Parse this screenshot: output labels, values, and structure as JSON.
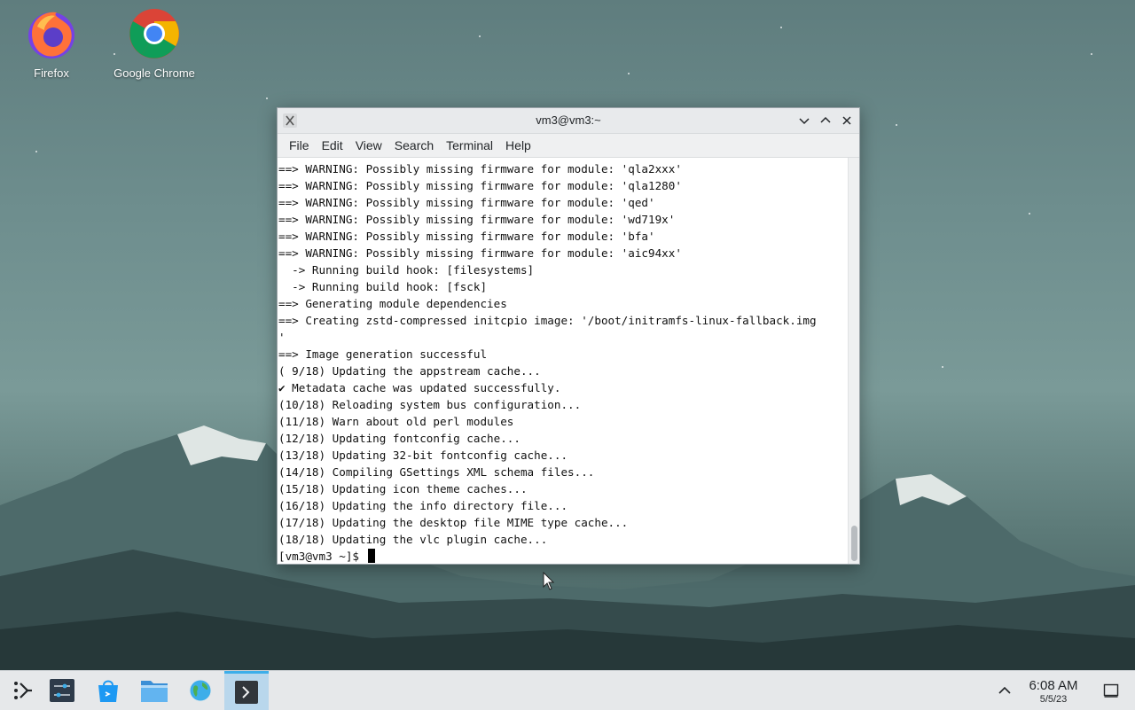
{
  "desktop": {
    "icons": [
      {
        "label": "Firefox"
      },
      {
        "label": "Google Chrome"
      }
    ]
  },
  "window": {
    "title": "vm3@vm3:~",
    "menu": [
      "File",
      "Edit",
      "View",
      "Search",
      "Terminal",
      "Help"
    ]
  },
  "terminal": {
    "lines": [
      "==> WARNING: Possibly missing firmware for module: 'qla2xxx'",
      "==> WARNING: Possibly missing firmware for module: 'qla1280'",
      "==> WARNING: Possibly missing firmware for module: 'qed'",
      "==> WARNING: Possibly missing firmware for module: 'wd719x'",
      "==> WARNING: Possibly missing firmware for module: 'bfa'",
      "==> WARNING: Possibly missing firmware for module: 'aic94xx'",
      "  -> Running build hook: [filesystems]",
      "  -> Running build hook: [fsck]",
      "==> Generating module dependencies",
      "==> Creating zstd-compressed initcpio image: '/boot/initramfs-linux-fallback.img",
      "'",
      "==> Image generation successful",
      "( 9/18) Updating the appstream cache...",
      "✔ Metadata cache was updated successfully.",
      "(10/18) Reloading system bus configuration...",
      "(11/18) Warn about old perl modules",
      "(12/18) Updating fontconfig cache...",
      "(13/18) Updating 32-bit fontconfig cache...",
      "(14/18) Compiling GSettings XML schema files...",
      "(15/18) Updating icon theme caches...",
      "(16/18) Updating the info directory file...",
      "(17/18) Updating the desktop file MIME type cache...",
      "(18/18) Updating the vlc plugin cache..."
    ],
    "prompt": "[vm3@vm3 ~]$ "
  },
  "taskbar": {
    "time": "6:08 AM",
    "date": "5/5/23"
  },
  "colors": {
    "accent": "#3daee9",
    "taskbar_bg": "#e6e8ea",
    "titlebar_bg": "#e8eaec"
  }
}
